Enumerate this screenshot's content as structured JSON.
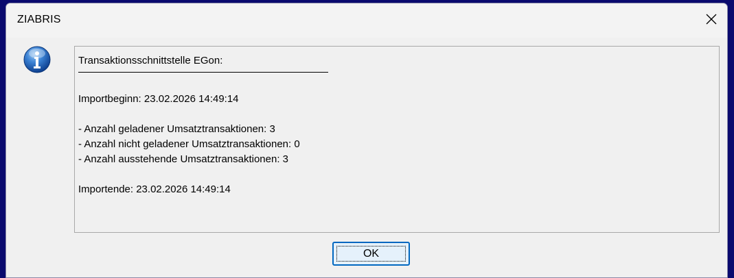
{
  "window": {
    "title": "ZIABRIS",
    "close_icon": "close-icon"
  },
  "icon": "info-icon",
  "message": {
    "heading": "Transaktionsschnittstelle EGon:",
    "separator": "____________________________________________",
    "import_start": "Importbeginn: 23.02.2026 14:49:14",
    "count_loaded": "- Anzahl geladener Umsatztransaktionen: 3",
    "count_not_loaded": "- Anzahl nicht geladener Umsatztransaktionen: 0",
    "count_pending": "- Anzahl ausstehende Umsatztransaktionen: 3",
    "import_end": "Importende: 23.02.2026 14:49:14"
  },
  "buttons": {
    "ok_label": "OK"
  },
  "colors": {
    "background": "#0a0a6e",
    "dialog": "#f0f0f0",
    "accent": "#0067c0"
  }
}
